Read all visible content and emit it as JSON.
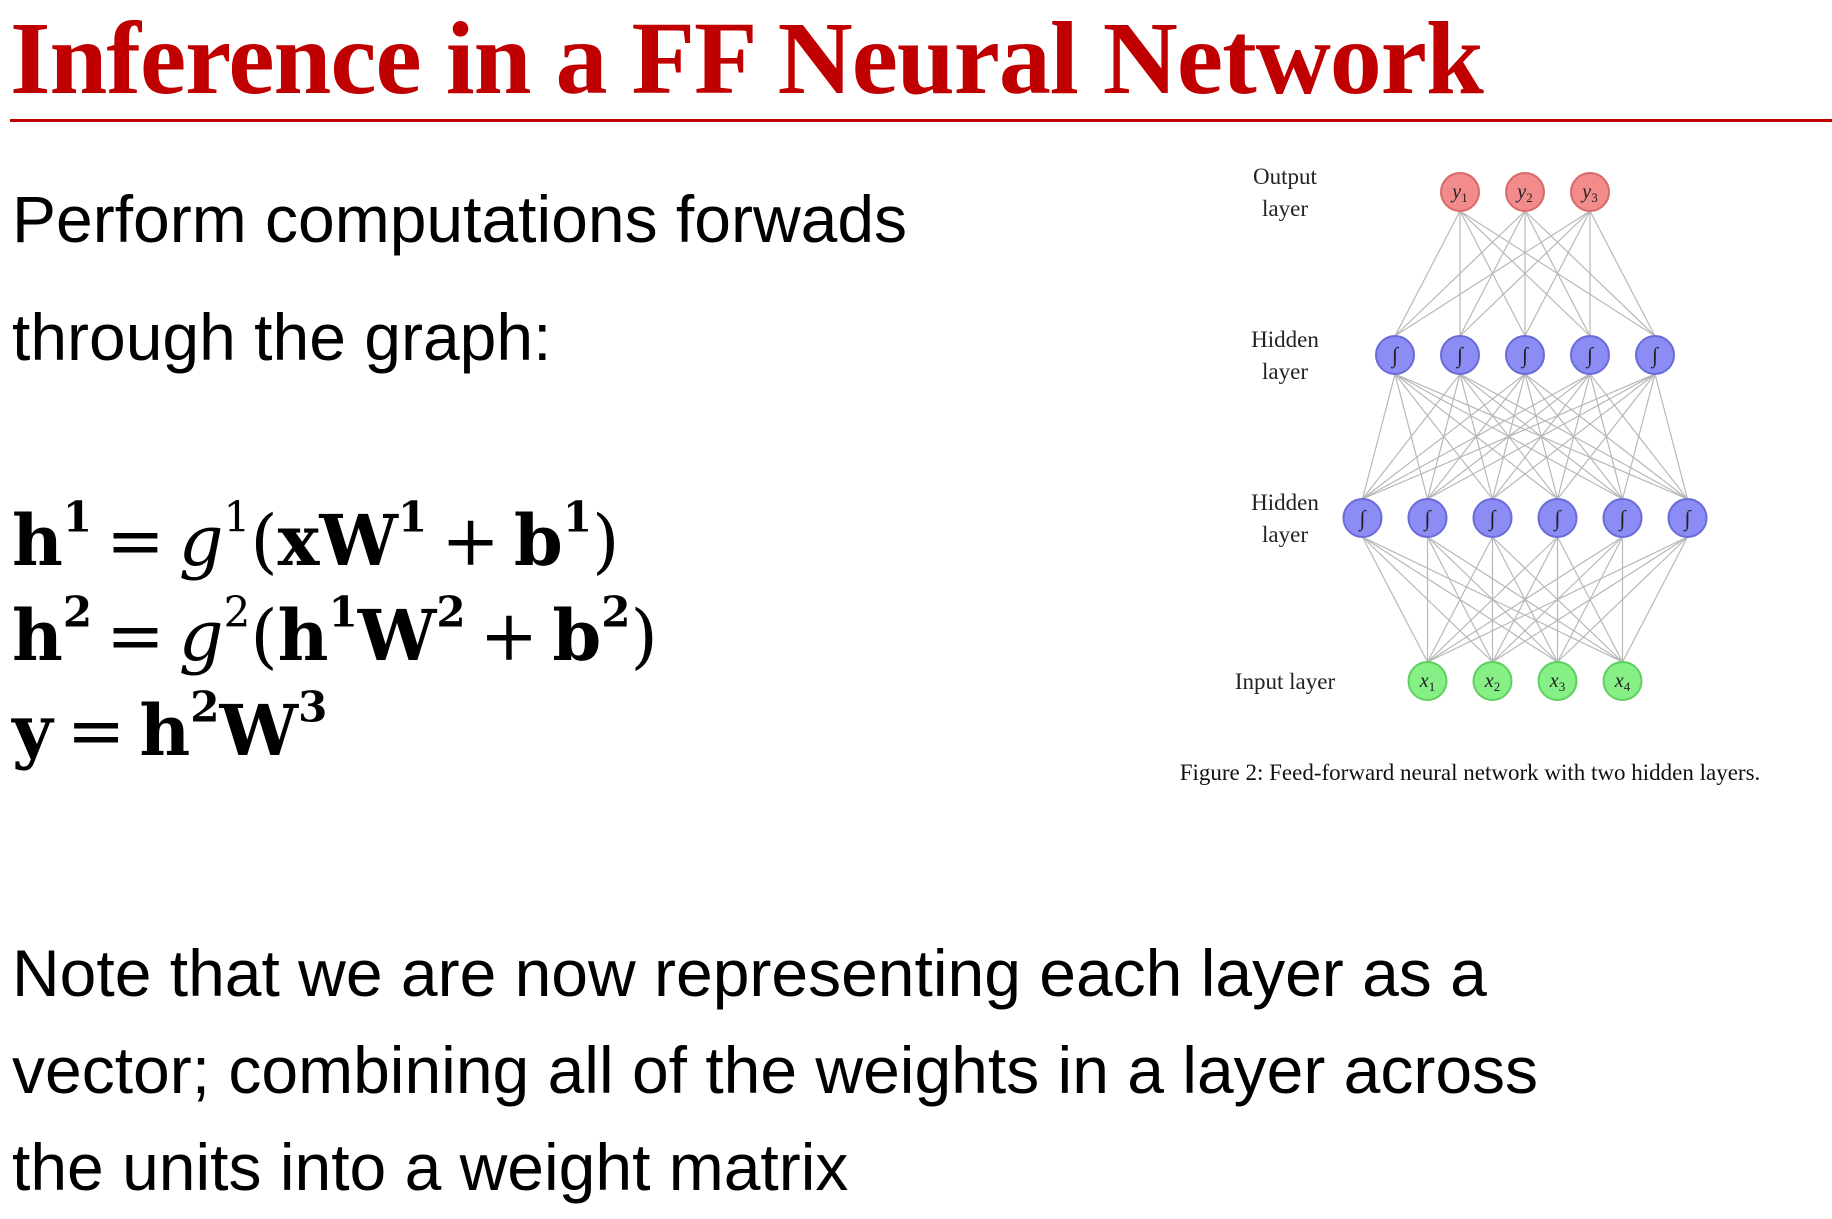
{
  "slide": {
    "title": "Inference in a FF Neural Network",
    "intro_line1": "Perform computations forwads",
    "intro_line2": "through the graph:",
    "note_line1": "Note that we are now representing each layer as a",
    "note_line2": "vector; combining all of the weights in a layer across",
    "note_line3": "the units into a weight matrix"
  },
  "equations": {
    "eq1": {
      "lhs": "h",
      "lhs_sup": "1",
      "eq": "=",
      "fn": "g",
      "fn_sup": "1",
      "open": "(",
      "in": "xW",
      "in_sup": "1",
      "plus": "+",
      "bias": "b",
      "bias_sup": "1",
      "close": ")"
    },
    "eq2": {
      "lhs": "h",
      "lhs_sup": "2",
      "eq": "=",
      "fn": "g",
      "fn_sup": "2",
      "open": "(",
      "in_a": "h",
      "in_a_sup": "1",
      "in_b": "W",
      "in_b_sup": "2",
      "plus": "+",
      "bias": "b",
      "bias_sup": "2",
      "close": ")"
    },
    "eq3": {
      "lhs": "y",
      "eq": "=",
      "a": "h",
      "a_sup": "2",
      "b": "W",
      "b_sup": "3"
    }
  },
  "diagram": {
    "caption": "Figure 2: Feed-forward neural network with two hidden layers.",
    "colors": {
      "output": "#f28b8b",
      "output_stroke": "#d86a6a",
      "hidden": "#8c8cf5",
      "hidden_stroke": "#6a6ad8",
      "input": "#86ef86",
      "input_stroke": "#5fcf5f",
      "edge": "#b8b8b8"
    },
    "layers": [
      {
        "label_line1": "Output",
        "label_line2": "layer",
        "kind": "output",
        "node_labels": [
          "y1",
          "y2",
          "y3"
        ]
      },
      {
        "label_line1": "Hidden",
        "label_line2": "layer",
        "kind": "hidden",
        "node_labels": [
          "∫",
          "∫",
          "∫",
          "∫",
          "∫"
        ]
      },
      {
        "label_line1": "Hidden",
        "label_line2": "layer",
        "kind": "hidden",
        "node_labels": [
          "∫",
          "∫",
          "∫",
          "∫",
          "∫",
          "∫"
        ]
      },
      {
        "label_line1": "Input layer",
        "label_line2": "",
        "kind": "input",
        "node_labels": [
          "x1",
          "x2",
          "x3",
          "x4"
        ]
      }
    ]
  }
}
